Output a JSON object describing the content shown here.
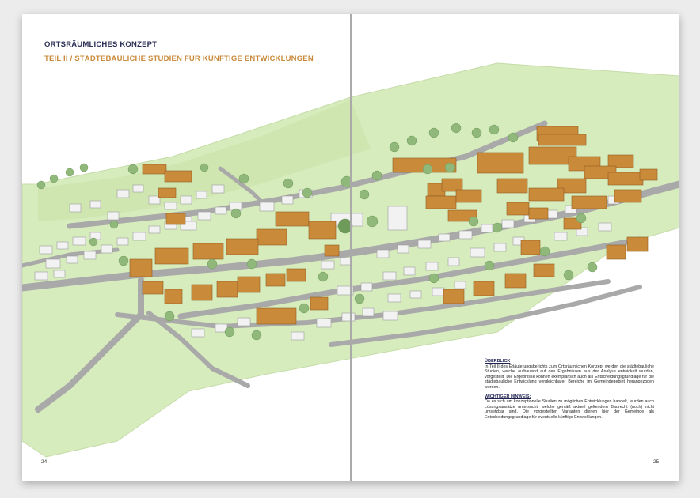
{
  "header": {
    "title": "ORTSRÄUMLICHES KONZEPT",
    "subtitle": "TEIL II / STÄDTEBAULICHE STUDIEN FÜR KÜNFTIGE ENTWICKLUNGEN"
  },
  "pages": {
    "left": "24",
    "right": "25"
  },
  "overview": {
    "heading": "ÜBERBLICK",
    "text": "In Teil II des Erläuterungsberichts zum Ortsräumlichen Konzept werden die städtebauliche Studien, welche aufbauend auf den Ergebnissen aus der Analyse entwickelt wurden, vorgestellt. Die Ergebnisse können exemplarisch auch als Entscheidungsgrundlage für die städtebauliche Entwicklung vergleichbarer Bereiche im Gemeindegebiet herangezogen werden."
  },
  "notice": {
    "heading": "WICHTIGER HINWEIS:",
    "text": "Da es sich um konzeptionelle Studien zu möglichen Entwicklungen handelt, wurden auch Lösungsansätze untersucht, welche gemäß aktuell geltendem Baurecht (noch) nicht umsetzbar sind. Die vorgestellten Varianten dienen hier der Gemeinde als Entscheidungsgrundlage für eventuelle künftige Entwicklungen."
  },
  "colors": {
    "title": "#2c2f55",
    "accent": "#c98a3a",
    "terrain": "#d7ecbd",
    "road": "#a9a9a9",
    "new_building": "#c98a3a",
    "existing_building": "#f2f2f2"
  }
}
